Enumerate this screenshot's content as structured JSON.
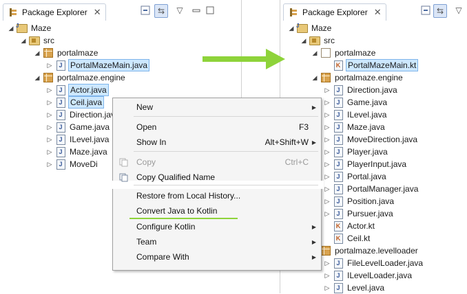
{
  "left_panel": {
    "tab_title": "Package Explorer",
    "tree": [
      {
        "label": "Maze",
        "icon": "project-icon",
        "twisty": "open"
      },
      {
        "label": "src",
        "icon": "source-folder-icon",
        "twisty": "open"
      },
      {
        "label": "portalmaze",
        "icon": "package-icon",
        "twisty": "open"
      },
      {
        "label": "PortalMazeMain.java",
        "icon": "java-file-icon",
        "twisty": "closed",
        "selected": true
      },
      {
        "label": "portalmaze.engine",
        "icon": "package-icon",
        "twisty": "open"
      },
      {
        "label": "Actor.java",
        "icon": "java-file-icon",
        "twisty": "closed",
        "selected": true
      },
      {
        "label": "Ceil.java",
        "icon": "java-file-icon",
        "twisty": "closed",
        "selected": true
      },
      {
        "label": "Direction.java",
        "icon": "java-file-icon",
        "twisty": "closed"
      },
      {
        "label": "Game.java",
        "icon": "java-file-icon",
        "twisty": "closed"
      },
      {
        "label": "ILevel.java",
        "icon": "java-file-icon",
        "twisty": "closed"
      },
      {
        "label": "Maze.java",
        "icon": "java-file-icon",
        "twisty": "closed"
      },
      {
        "label": "MoveDi",
        "icon": "java-file-icon",
        "twisty": "closed"
      }
    ]
  },
  "right_panel": {
    "tab_title": "Package Explorer",
    "tree": [
      {
        "label": "Maze",
        "icon": "project-icon",
        "twisty": "open"
      },
      {
        "label": "src",
        "icon": "source-folder-icon",
        "twisty": "open"
      },
      {
        "label": "portalmaze",
        "icon": "package-empty-icon",
        "twisty": "open"
      },
      {
        "label": "PortalMazeMain.kt",
        "icon": "kotlin-file-icon",
        "twisty": "",
        "selected": true
      },
      {
        "label": "portalmaze.engine",
        "icon": "package-icon",
        "twisty": "open"
      },
      {
        "label": "Direction.java",
        "icon": "java-file-icon",
        "twisty": "closed"
      },
      {
        "label": "Game.java",
        "icon": "java-file-icon",
        "twisty": "closed"
      },
      {
        "label": "ILevel.java",
        "icon": "java-file-icon",
        "twisty": "closed"
      },
      {
        "label": "Maze.java",
        "icon": "java-file-icon",
        "twisty": "closed"
      },
      {
        "label": "MoveDirection.java",
        "icon": "java-file-icon",
        "twisty": "closed"
      },
      {
        "label": "Player.java",
        "icon": "java-file-icon",
        "twisty": "closed"
      },
      {
        "label": "PlayerInput.java",
        "icon": "java-file-icon",
        "twisty": "closed"
      },
      {
        "label": "Portal.java",
        "icon": "java-file-icon",
        "twisty": "closed"
      },
      {
        "label": "PortalManager.java",
        "icon": "java-file-icon",
        "twisty": "closed"
      },
      {
        "label": "Position.java",
        "icon": "java-file-icon",
        "twisty": "closed"
      },
      {
        "label": "Pursuer.java",
        "icon": "java-file-icon",
        "twisty": "closed"
      },
      {
        "label": "Actor.kt",
        "icon": "kotlin-file-icon",
        "twisty": ""
      },
      {
        "label": "Ceil.kt",
        "icon": "kotlin-file-icon",
        "twisty": ""
      },
      {
        "label": "portalmaze.levelloader",
        "icon": "package-icon",
        "twisty": "open"
      },
      {
        "label": "FileLevelLoader.java",
        "icon": "java-file-icon",
        "twisty": "closed"
      },
      {
        "label": "ILevelLoader.java",
        "icon": "java-file-icon",
        "twisty": "closed"
      },
      {
        "label": "Level.java",
        "icon": "java-file-icon",
        "twisty": "closed"
      }
    ]
  },
  "context_menu": {
    "items": [
      {
        "label": "New",
        "accel": "",
        "submenu": true,
        "disabled": false
      },
      {
        "label": "Open",
        "accel": "F3",
        "submenu": false,
        "disabled": false
      },
      {
        "label": "Show In",
        "accel": "Alt+Shift+W",
        "submenu": true,
        "disabled": false
      },
      {
        "label": "Copy",
        "accel": "Ctrl+C",
        "submenu": false,
        "disabled": true
      },
      {
        "label": "Copy Qualified Name",
        "accel": "",
        "submenu": false,
        "disabled": false
      },
      {
        "label": "Restore from Local History...",
        "accel": "",
        "submenu": false,
        "disabled": false
      },
      {
        "label": "Convert Java to Kotlin",
        "accel": "",
        "submenu": false,
        "disabled": false
      },
      {
        "label": "Configure Kotlin",
        "accel": "",
        "submenu": true,
        "disabled": false
      },
      {
        "label": "Team",
        "accel": "",
        "submenu": true,
        "disabled": false
      },
      {
        "label": "Compare With",
        "accel": "",
        "submenu": true,
        "disabled": false
      }
    ]
  },
  "colors": {
    "arrow": "#8ed33a",
    "selection": "#cde8ff",
    "highlight_underline": "#8ed33a"
  }
}
